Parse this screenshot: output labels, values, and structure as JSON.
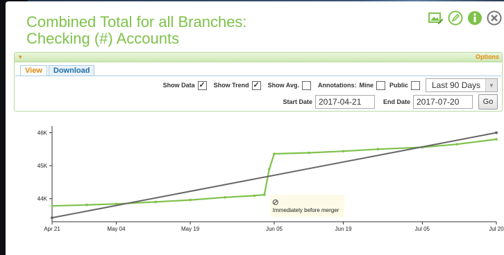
{
  "title": [
    "Combined Total for all Branches:",
    "Checking (#) Accounts"
  ],
  "header_icons": [
    "image-edit-icon",
    "pencil-icon",
    "info-icon",
    "close-icon"
  ],
  "panel": {
    "options_label": "Options",
    "tabs": [
      {
        "label": "View",
        "active": true
      },
      {
        "label": "Download",
        "active": false
      }
    ]
  },
  "controls": {
    "show_data": {
      "label": "Show Data",
      "checked": true
    },
    "show_trend": {
      "label": "Show Trend",
      "checked": true
    },
    "show_avg": {
      "label": "Show Avg.",
      "checked": false
    },
    "annotations_label": "Annotations:",
    "mine": {
      "label": "Mine",
      "checked": false
    },
    "public": {
      "label": "Public",
      "checked": false
    },
    "range_select": "Last 90 Days",
    "start_date_label": "Start Date",
    "start_date": "2017-04-21",
    "end_date_label": "End Date",
    "end_date": "2017-07-20",
    "go_label": "Go"
  },
  "colors": {
    "accent": "#7fc24b",
    "trend": "#666666",
    "options": "#e08a10",
    "tab": "#1f6ea8"
  },
  "chart_data": {
    "type": "line",
    "x_ticks": [
      "Apr 21",
      "May 04",
      "May 19",
      "Jun 05",
      "Jun 19",
      "Jul 05",
      "Jul 20"
    ],
    "y_ticks": [
      "44K",
      "45K",
      "46K"
    ],
    "ylim": [
      43300,
      46200
    ],
    "series": [
      {
        "values": [
          {
            "x": "2017-04-21",
            "y": 43780
          },
          {
            "x": "2017-04-28",
            "y": 43810
          },
          {
            "x": "2017-05-04",
            "y": 43840
          },
          {
            "x": "2017-05-12",
            "y": 43900
          },
          {
            "x": "2017-05-19",
            "y": 43960
          },
          {
            "x": "2017-05-26",
            "y": 44040
          },
          {
            "x": "2017-06-01",
            "y": 44090
          },
          {
            "x": "2017-06-03",
            "y": 44120
          },
          {
            "x": "2017-06-04",
            "y": 44900
          },
          {
            "x": "2017-06-05",
            "y": 45360
          },
          {
            "x": "2017-06-12",
            "y": 45390
          },
          {
            "x": "2017-06-19",
            "y": 45440
          },
          {
            "x": "2017-06-26",
            "y": 45500
          },
          {
            "x": "2017-07-05",
            "y": 45560
          },
          {
            "x": "2017-07-12",
            "y": 45650
          },
          {
            "x": "2017-07-20",
            "y": 45800
          }
        ]
      },
      {
        "values": [
          {
            "x": "2017-04-21",
            "y": 43420
          },
          {
            "x": "2017-07-20",
            "y": 46000
          }
        ]
      }
    ],
    "annotations": [
      {
        "x": "2017-06-03",
        "y": 44080,
        "text": "Immediately before merger"
      }
    ]
  }
}
